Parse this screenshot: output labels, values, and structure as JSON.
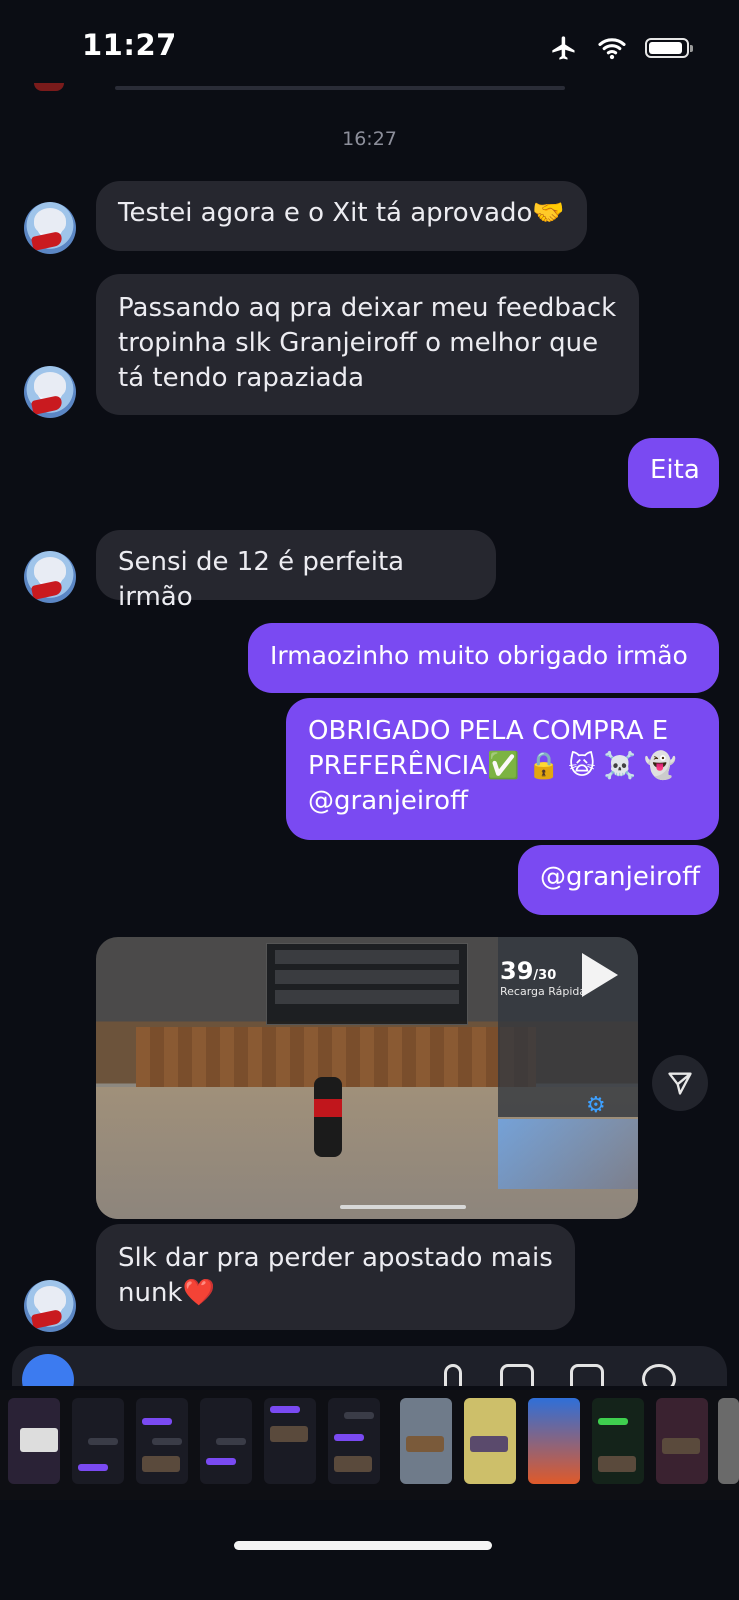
{
  "status": {
    "time": "11:27"
  },
  "chat": {
    "timestamp": "16:27",
    "messages": [
      {
        "from": "other",
        "text": "Testei agora e o Xit tá aprovado🤝"
      },
      {
        "from": "other",
        "text": "Passando aq pra deixar meu feedback tropinha slk Granjeiroff o melhor que tá tendo rapaziada"
      },
      {
        "from": "me",
        "text": "Eita"
      },
      {
        "from": "other",
        "text": "Sensi de 12 é perfeita irmão"
      },
      {
        "from": "me",
        "text": "Irmaozinho muito obrigado irmão"
      },
      {
        "from": "me",
        "text": "OBRIGADO PELA COMPRA E PREFERÊNCIA✅ 🔒 🙀 ☠️ 👻 @granjeiroff"
      },
      {
        "from": "me",
        "text": "@granjeiroff"
      },
      {
        "from": "other",
        "text": "Slk dar pra perder apostado mais nunk❤️"
      }
    ],
    "video": {
      "counter": "39",
      "counter_max": "/30",
      "caption": "Recarga Rápida"
    }
  },
  "colors": {
    "background": "#0b0d14",
    "incoming_bubble": "#26272f",
    "outgoing_bubble": "#7a4af2"
  },
  "icons": [
    "airplane-icon",
    "wifi-icon",
    "battery-icon",
    "share-icon",
    "play-icon",
    "gear-icon",
    "camera-icon",
    "microphone-icon",
    "gallery-icon",
    "sticker-icon"
  ]
}
